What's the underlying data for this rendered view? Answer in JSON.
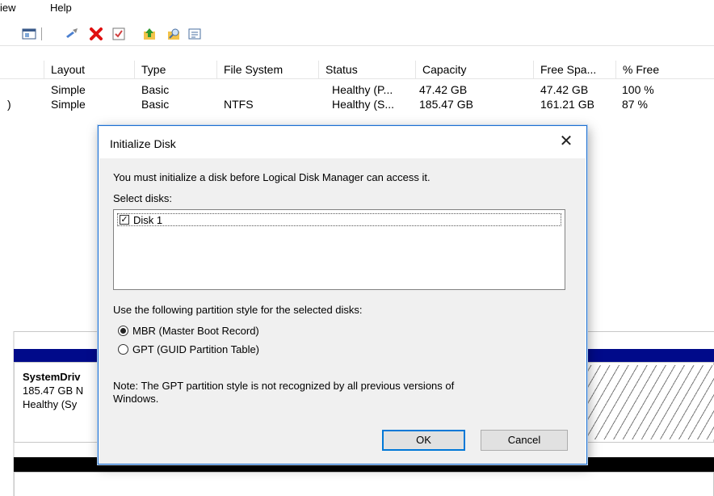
{
  "menubar": {
    "view_partial": "iew",
    "help": "Help"
  },
  "toolbar": {
    "icons": [
      "console-view-icon",
      "connect-icon",
      "delete-icon",
      "checklist-icon",
      "up-arrow-icon",
      "search-folder-icon",
      "properties-icon"
    ],
    "colors": {
      "delete": "#e01010",
      "up": "#2e9a2e"
    }
  },
  "volumes": {
    "columns": [
      "Layout",
      "Type",
      "File System",
      "Status",
      "Capacity",
      "Free Spa...",
      "% Free"
    ],
    "rows": [
      {
        "name": "",
        "layout": "Simple",
        "type": "Basic",
        "fs": "",
        "status": "Healthy (P...",
        "capacity": "47.42 GB",
        "free": "47.42 GB",
        "pct": "100 %"
      },
      {
        "name": ")",
        "layout": "Simple",
        "type": "Basic",
        "fs": "NTFS",
        "status": "Healthy (S...",
        "capacity": "185.47 GB",
        "free": "161.21 GB",
        "pct": "87 %"
      }
    ]
  },
  "lower": {
    "volume_name": "SystemDriv",
    "volume_size": "185.47 GB N",
    "volume_status": "Healthy (Sy"
  },
  "dialog": {
    "title": "Initialize Disk",
    "close": "✕",
    "intro": "You must initialize a disk before Logical Disk Manager can access it.",
    "select_label": "Select disks:",
    "disks": [
      {
        "label": "Disk 1",
        "checked": true
      }
    ],
    "partition_label": "Use the following partition style for the selected disks:",
    "options": [
      {
        "label": "MBR (Master Boot Record)",
        "selected": true
      },
      {
        "label": "GPT (GUID Partition Table)",
        "selected": false
      }
    ],
    "note_line1": "Note: The GPT partition style is not recognized by all previous versions of",
    "note_line2": "Windows.",
    "ok": "OK",
    "cancel": "Cancel",
    "accent": "#0078d7"
  }
}
